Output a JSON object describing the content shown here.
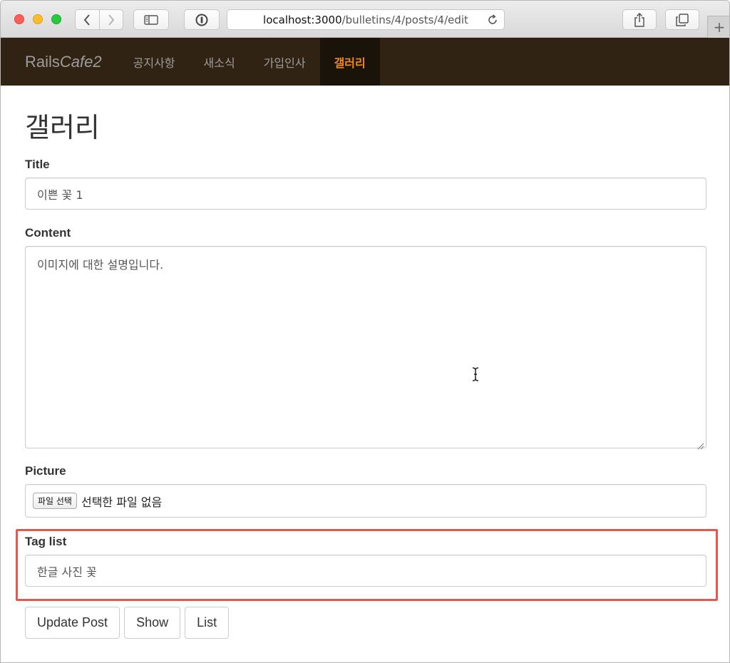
{
  "browser": {
    "url_host": "localhost:3000",
    "url_path": "/bulletins/4/posts/4/edit",
    "new_tab_glyph": "+"
  },
  "navbar": {
    "brand_regular": "Rails",
    "brand_italic": "Cafe2",
    "items": [
      {
        "label": "공지사항",
        "active": false
      },
      {
        "label": "새소식",
        "active": false
      },
      {
        "label": "가입인사",
        "active": false
      },
      {
        "label": "갤러리",
        "active": true
      }
    ],
    "background_color": "#302313",
    "active_color": "#ef8b1a"
  },
  "page": {
    "title": "갤러리"
  },
  "form": {
    "title_label": "Title",
    "title_value": "이쁜 꽃 1",
    "content_label": "Content",
    "content_value": "이미지에 대한 설명입니다.",
    "picture_label": "Picture",
    "file_button_label": "파일 선택",
    "file_status": "선택한 파일 없음",
    "tag_list_label": "Tag list",
    "tag_list_value": "한글 사진 꽃",
    "highlight_color": "#e8584a"
  },
  "buttons": {
    "update": "Update Post",
    "show": "Show",
    "list": "List"
  },
  "icons": {
    "back": "chevron-left-icon",
    "forward": "chevron-right-icon",
    "sidebar": "sidebar-icon",
    "privacy": "privacy-icon",
    "reload": "reload-icon",
    "share": "share-icon",
    "tabs": "tabs-icon",
    "cursor": "text-cursor-icon"
  }
}
